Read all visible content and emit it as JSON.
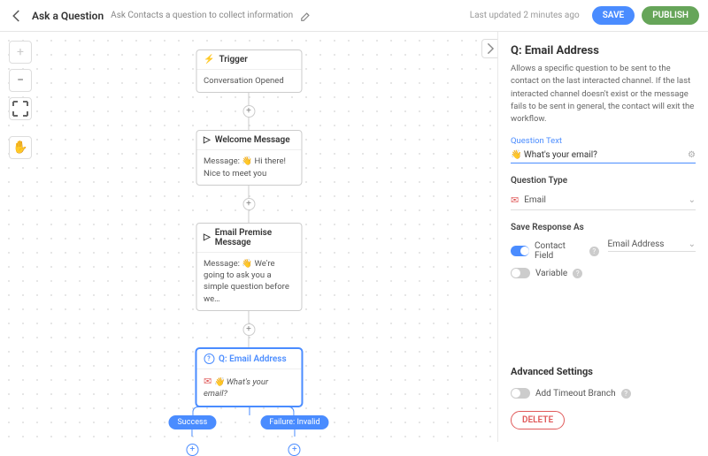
{
  "header": {
    "title": "Ask a Question",
    "subtitle": "Ask Contacts a question to collect information",
    "updated": "Last updated 2 minutes ago",
    "save": "SAVE",
    "publish": "PUBLISH"
  },
  "flow": {
    "trigger": {
      "title": "Trigger",
      "body": "Conversation Opened"
    },
    "welcome": {
      "title": "Welcome Message",
      "body": "Message: 👋 Hi there! Nice to meet you"
    },
    "premise": {
      "title": "Email Premise Message",
      "body": "Message: 👋 We're going to ask you a simple question before we…"
    },
    "question": {
      "title": "Q: Email Address",
      "body": "👋 What's your email?"
    },
    "branches": {
      "success": "Success",
      "failure": "Failure: Invalid"
    }
  },
  "panel": {
    "title": "Q: Email Address",
    "desc": "Allows a specific question to be sent to the contact on the last interacted channel. If the last interacted channel doesn't exist or the message fails to be sent in general, the contact will exit the workflow.",
    "qtext_label": "Question Text",
    "qtext_value": "👋 What's your email?",
    "qtype_label": "Question Type",
    "qtype_value": "Email",
    "save_as_label": "Save Response As",
    "contact_field": "Contact Field",
    "contact_field_value": "Email Address",
    "variable": "Variable",
    "advanced": "Advanced Settings",
    "timeout": "Add Timeout Branch",
    "delete": "DELETE"
  }
}
